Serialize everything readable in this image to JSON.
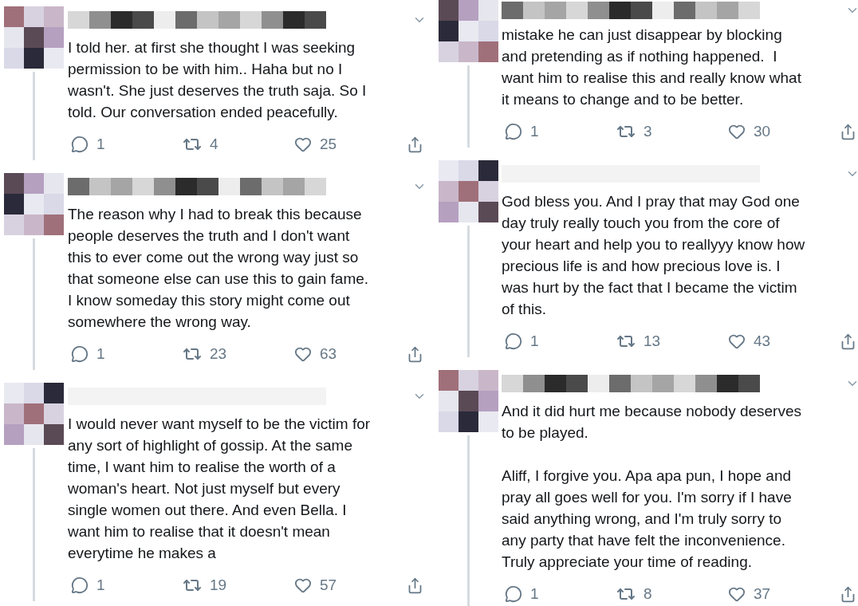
{
  "columns": [
    {
      "tweets": [
        {
          "text": "I told her. at first she thought I was seeking\npermission to be with him.. Haha but no I\nwasn't. She just deserves the truth saja. So I\ntold. Our conversation ended peacefully.",
          "replies": "1",
          "retweets": "4",
          "likes": "25"
        },
        {
          "text": "The reason why I had to break this because\npeople deserves the truth and I don't want\nthis to ever come out the wrong way just so\nthat someone else can use this to gain fame.\nI know someday this story might come out\nsomewhere the wrong way.",
          "replies": "1",
          "retweets": "23",
          "likes": "63"
        },
        {
          "text": "I would never want myself to be the victim for\nany sort of highlight of gossip. At the same\ntime, I want him to realise the worth of a\nwoman's heart. Not just myself but every\nsingle women out there. And even Bella. I\nwant him to realise that it doesn't mean\neverytime he makes a",
          "replies": "1",
          "retweets": "19",
          "likes": "57"
        }
      ]
    },
    {
      "tweets": [
        {
          "text": "mistake he can just disappear by blocking\nand pretending as if nothing happened.  I\nwant him to realise this and really know what\nit means to change and to be better.",
          "replies": "1",
          "retweets": "3",
          "likes": "30"
        },
        {
          "text": "God bless you. And I pray that may God one\nday truly really touch you from the core of\nyour heart and help you to reallyyy know how\nprecious life is and how precious love is. I\nwas hurt by the fact that I became the victim\nof this.",
          "replies": "1",
          "retweets": "13",
          "likes": "43"
        },
        {
          "text": "And it did hurt me because nobody deserves\nto be played.\n\nAliff, I forgive you. Apa apa pun, I hope and\npray all goes well for you. I'm sorry if I have\nsaid anything wrong, and I'm truly sorry to\nany party that have felt the inconvenience.\nTruly appreciate your time of reading.",
          "replies": "1",
          "retweets": "8",
          "likes": "37"
        }
      ]
    }
  ]
}
